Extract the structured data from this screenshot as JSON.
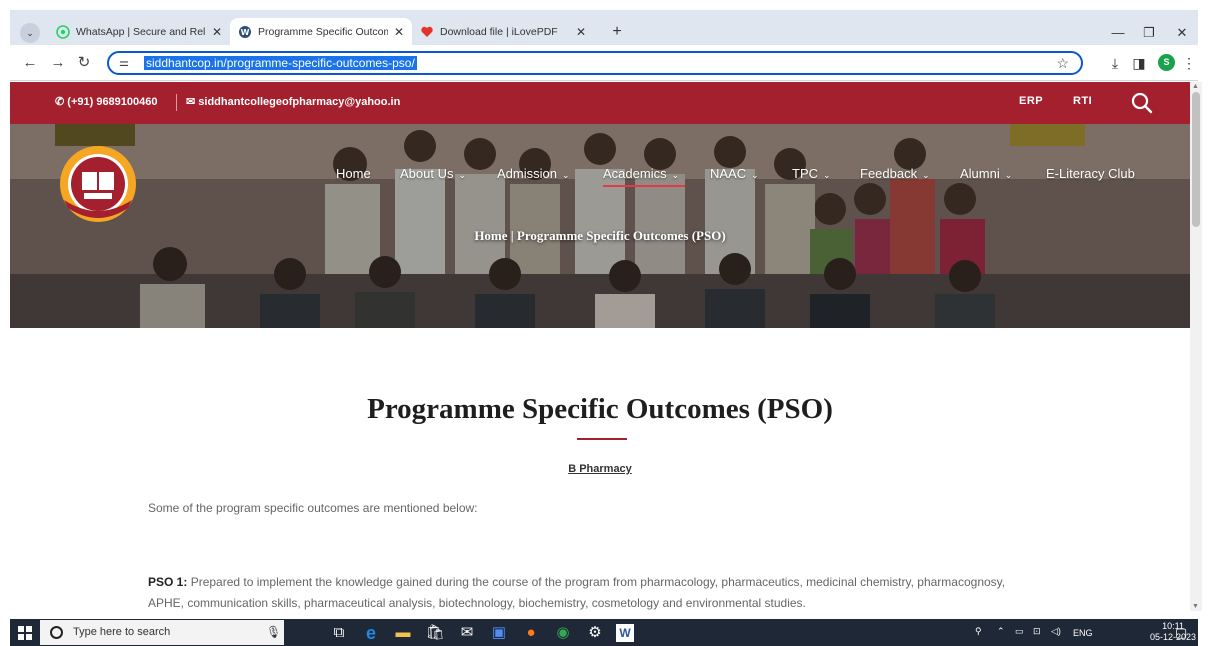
{
  "browser": {
    "tabs": [
      {
        "title": "WhatsApp | Secure and Reliab",
        "icon": "whatsapp-icon",
        "active": false
      },
      {
        "title": "Programme Specific Outcomes",
        "icon": "wordpress-icon",
        "active": true
      },
      {
        "title": "Download file | iLovePDF",
        "icon": "ilovepdf-icon",
        "active": false
      }
    ],
    "url": "siddhantcop.in/programme-specific-outcomes-pso/",
    "profile_initial": "S"
  },
  "site": {
    "phone": "(+91) 9689100460",
    "email": "siddhantcollegeofpharmacy@yahoo.in",
    "top_links": [
      "ERP",
      "RTI"
    ],
    "accent_color": "#a4202e"
  },
  "nav": {
    "items": [
      {
        "label": "Home",
        "dropdown": false
      },
      {
        "label": "About Us",
        "dropdown": true
      },
      {
        "label": "Admission",
        "dropdown": true
      },
      {
        "label": "Academics",
        "dropdown": true,
        "active": true
      },
      {
        "label": "NAAC",
        "dropdown": true
      },
      {
        "label": "TPC",
        "dropdown": true
      },
      {
        "label": "Feedback",
        "dropdown": true
      },
      {
        "label": "Alumni",
        "dropdown": true
      },
      {
        "label": "E-Literacy Club",
        "dropdown": false
      }
    ]
  },
  "hero": {
    "breadcrumb": "Home | Programme Specific Outcomes (PSO)"
  },
  "content": {
    "title": "Programme Specific Outcomes (PSO)",
    "subheading": "B Pharmacy",
    "intro": "Some of the program specific outcomes are mentioned below:",
    "pso1_label": "PSO 1:",
    "pso1_text": " Prepared to implement the knowledge gained during the course of the program from pharmacology, pharmaceutics, medicinal chemistry, pharmacognosy, APHE, communication skills, pharmaceutical analysis, biotechnology, biochemistry, cosmetology and environmental studies."
  },
  "taskbar": {
    "search_placeholder": "Type here to search",
    "language": "ENG",
    "time": "10:11",
    "date": "05-12-2023"
  }
}
